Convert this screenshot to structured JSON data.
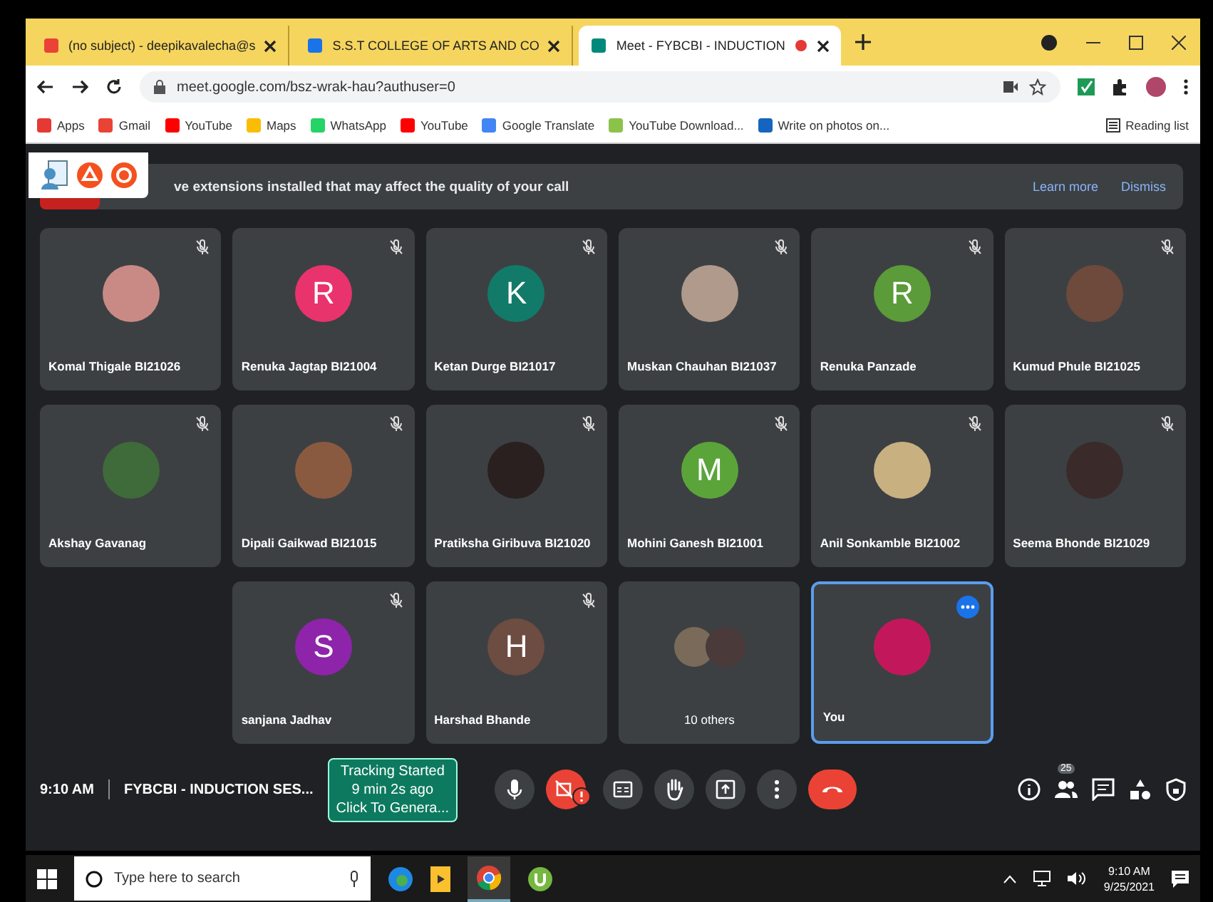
{
  "browser": {
    "tabs": [
      {
        "kind": "gmail",
        "title": "(no subject) - deepikavalecha@s",
        "selected": false,
        "recording": false
      },
      {
        "kind": "site",
        "title": "S.S.T COLLEGE OF ARTS AND CO",
        "selected": false,
        "recording": false
      },
      {
        "kind": "meet",
        "title": "Meet - FYBCBI - INDUCTION",
        "selected": true,
        "recording": true
      }
    ],
    "address": "meet.google.com/bsz-wrak-hau?authuser=0",
    "bookmarks": [
      {
        "kind": "apps",
        "label": "Apps"
      },
      {
        "kind": "gmail",
        "label": "Gmail"
      },
      {
        "kind": "youtube",
        "label": "YouTube"
      },
      {
        "kind": "maps",
        "label": "Maps"
      },
      {
        "kind": "whatsapp",
        "label": "WhatsApp"
      },
      {
        "kind": "youtube",
        "label": "YouTube"
      },
      {
        "kind": "translate",
        "label": "Google Translate"
      },
      {
        "kind": "download",
        "label": "YouTube Download..."
      },
      {
        "kind": "photo",
        "label": "Write on photos on..."
      }
    ],
    "reading_list": "Reading list"
  },
  "meet": {
    "banner": {
      "text": "ve extensions installed that may affect the quality of your call",
      "actions": [
        "Learn more",
        "Dismiss"
      ]
    },
    "tiles": [
      {
        "kind": "photo",
        "name": "Komal Thigale BI21026",
        "muted": true,
        "highlighted": false,
        "color": "#c98a86"
      },
      {
        "kind": "letter",
        "letter": "R",
        "name": "Renuka Jagtap BI21004",
        "muted": true,
        "highlighted": false,
        "color": "#e8336d"
      },
      {
        "kind": "letter",
        "letter": "K",
        "name": "Ketan Durge BI21017",
        "muted": true,
        "highlighted": false,
        "color": "#127a68"
      },
      {
        "kind": "photo",
        "name": "Muskan Chauhan BI21037",
        "muted": true,
        "highlighted": false,
        "color": "#b09a8c"
      },
      {
        "kind": "letter",
        "letter": "R",
        "name": "Renuka Panzade",
        "muted": true,
        "highlighted": false,
        "color": "#5b9b3a"
      },
      {
        "kind": "photo",
        "name": "Kumud Phule BI21025",
        "muted": true,
        "highlighted": false,
        "color": "#6e4a3c"
      },
      {
        "kind": "photo",
        "name": "Akshay Gavanag",
        "muted": true,
        "highlighted": false,
        "color": "#3f6a3a"
      },
      {
        "kind": "photo",
        "name": "Dipali Gaikwad BI21015",
        "muted": true,
        "highlighted": false,
        "color": "#8a5a40"
      },
      {
        "kind": "photo",
        "name": "Pratiksha Giribuva BI21020",
        "muted": true,
        "highlighted": false,
        "color": "#2a2020"
      },
      {
        "kind": "letter",
        "letter": "M",
        "name": "Mohini Ganesh BI21001",
        "muted": true,
        "highlighted": false,
        "color": "#5ba43a"
      },
      {
        "kind": "photo",
        "name": "Anil Sonkamble BI21002",
        "muted": true,
        "highlighted": false,
        "color": "#c9b080"
      },
      {
        "kind": "photo",
        "name": "Seema Bhonde BI21029",
        "muted": true,
        "highlighted": false,
        "color": "#3a2a2a"
      },
      {
        "kind": "empty"
      },
      {
        "kind": "letter",
        "letter": "S",
        "name": "sanjana Jadhav",
        "muted": true,
        "highlighted": false,
        "color": "#8e24aa"
      },
      {
        "kind": "letter",
        "letter": "H",
        "name": "Harshad Bhande",
        "muted": true,
        "highlighted": false,
        "color": "#6d4c41"
      },
      {
        "kind": "others",
        "name": "10 others",
        "muted": false,
        "highlighted": false
      },
      {
        "kind": "photo",
        "name": "You",
        "muted": false,
        "highlighted": true,
        "color": "#c2185b"
      }
    ],
    "bottom": {
      "time": "9:10 AM",
      "meeting": "FYBCBI - INDUCTION SES...",
      "tracking": [
        "Tracking Started",
        "9 min 2s ago",
        "Click To Genera..."
      ],
      "controls": [
        {
          "kind": "mic"
        },
        {
          "kind": "camera-off"
        },
        {
          "kind": "captions"
        },
        {
          "kind": "hand"
        },
        {
          "kind": "present"
        },
        {
          "kind": "more"
        },
        {
          "kind": "leave"
        }
      ],
      "people_count": "25"
    }
  },
  "taskbar": {
    "search_placeholder": "Type here to search",
    "time": "9:10 AM",
    "date": "9/25/2021"
  }
}
